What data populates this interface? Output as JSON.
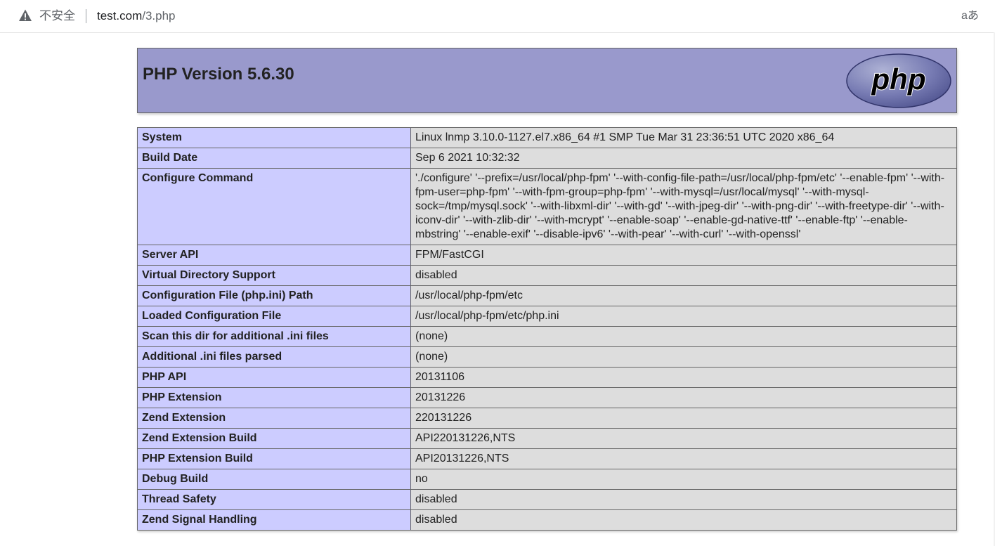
{
  "browser": {
    "security_text": "不安全",
    "url_host": "test.com",
    "url_path": "/3.php",
    "reader_label": "aあ"
  },
  "header": {
    "title": "PHP Version 5.6.30",
    "logo_text": "php"
  },
  "rows": [
    {
      "key": "System",
      "value": "Linux lnmp 3.10.0-1127.el7.x86_64 #1 SMP Tue Mar 31 23:36:51 UTC 2020 x86_64"
    },
    {
      "key": "Build Date",
      "value": "Sep 6 2021 10:32:32"
    },
    {
      "key": "Configure Command",
      "value": "'./configure' '--prefix=/usr/local/php-fpm' '--with-config-file-path=/usr/local/php-fpm/etc' '--enable-fpm' '--with-fpm-user=php-fpm' '--with-fpm-group=php-fpm' '--with-mysql=/usr/local/mysql' '--with-mysql-sock=/tmp/mysql.sock' '--with-libxml-dir' '--with-gd' '--with-jpeg-dir' '--with-png-dir' '--with-freetype-dir' '--with-iconv-dir' '--with-zlib-dir' '--with-mcrypt' '--enable-soap' '--enable-gd-native-ttf' '--enable-ftp' '--enable-mbstring' '--enable-exif' '--disable-ipv6' '--with-pear' '--with-curl' '--with-openssl'"
    },
    {
      "key": "Server API",
      "value": "FPM/FastCGI"
    },
    {
      "key": "Virtual Directory Support",
      "value": "disabled"
    },
    {
      "key": "Configuration File (php.ini) Path",
      "value": "/usr/local/php-fpm/etc"
    },
    {
      "key": "Loaded Configuration File",
      "value": "/usr/local/php-fpm/etc/php.ini"
    },
    {
      "key": "Scan this dir for additional .ini files",
      "value": "(none)"
    },
    {
      "key": "Additional .ini files parsed",
      "value": "(none)"
    },
    {
      "key": "PHP API",
      "value": "20131106"
    },
    {
      "key": "PHP Extension",
      "value": "20131226"
    },
    {
      "key": "Zend Extension",
      "value": "220131226"
    },
    {
      "key": "Zend Extension Build",
      "value": "API220131226,NTS"
    },
    {
      "key": "PHP Extension Build",
      "value": "API20131226,NTS"
    },
    {
      "key": "Debug Build",
      "value": "no"
    },
    {
      "key": "Thread Safety",
      "value": "disabled"
    },
    {
      "key": "Zend Signal Handling",
      "value": "disabled"
    }
  ]
}
